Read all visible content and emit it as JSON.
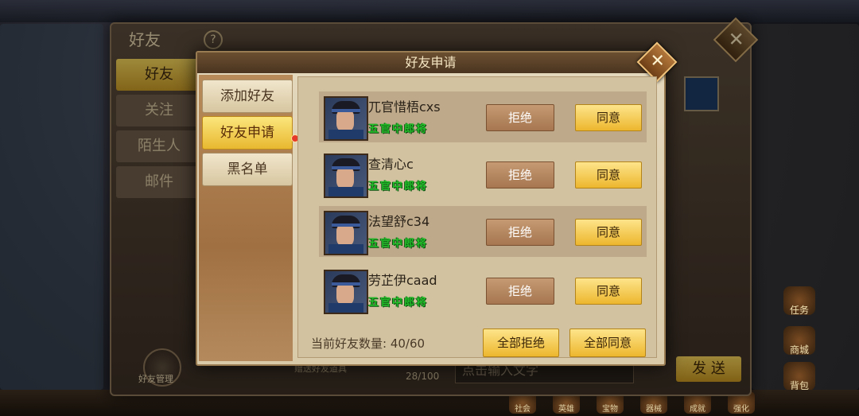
{
  "background": {
    "panel_title": "好友",
    "help_symbol": "?",
    "close_symbol": "✕",
    "tabs": [
      {
        "label": "好友",
        "active": true
      },
      {
        "label": "关注",
        "active": false
      },
      {
        "label": "陌生人",
        "active": false
      },
      {
        "label": "邮件",
        "active": false
      }
    ],
    "friends_management_label": "好友管理",
    "input_placeholder": "点击输入文字",
    "hint_text": "赠送好友道具",
    "message_count": "28/100",
    "send_label": "发 送"
  },
  "dialog": {
    "title": "好友申请",
    "close_symbol": "✕",
    "tabs": [
      {
        "label": "添加好友",
        "active": false
      },
      {
        "label": "好友申请",
        "active": true
      },
      {
        "label": "黑名单",
        "active": false
      }
    ],
    "requests": [
      {
        "name": "兀官惜梧cxs",
        "rank": "五官中郎将",
        "reject": "拒绝",
        "accept": "同意"
      },
      {
        "name": "查清心c",
        "rank": "五官中郎将",
        "reject": "拒绝",
        "accept": "同意"
      },
      {
        "name": "法望舒c34",
        "rank": "五官中郎将",
        "reject": "拒绝",
        "accept": "同意"
      },
      {
        "name": "劳芷伊caad",
        "rank": "五官中郎将",
        "reject": "拒绝",
        "accept": "同意"
      }
    ],
    "friend_count_label": "当前好友数量:",
    "friend_count_value": "40/60",
    "reject_all_label": "全部拒绝",
    "accept_all_label": "全部同意"
  },
  "hud": {
    "right_icons": [
      "任务",
      "商城",
      "背包"
    ],
    "bottom_icons": [
      "社会",
      "英雄",
      "宝物",
      "器械",
      "成就",
      "强化"
    ]
  },
  "colors": {
    "accent_gold": "#edb72e",
    "reject_brown": "#a67650",
    "rank_green": "#23c02a",
    "notification_red": "#e53a2a"
  }
}
